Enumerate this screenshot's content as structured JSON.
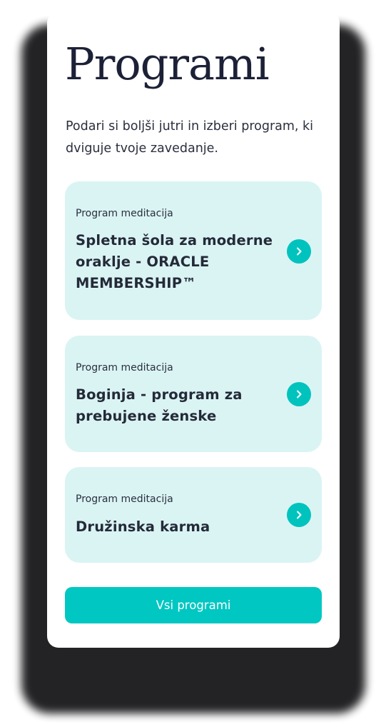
{
  "page": {
    "title": "Programi",
    "subtitle": "Podari si boljši jutri in izberi program, ki dviguje tvoje zavedanje."
  },
  "programs": [
    {
      "tag": "Program meditacija",
      "title": "Spletna šola za moderne oraklje - ORACLE MEMBERSHIP™",
      "icon": "chevron-right-icon"
    },
    {
      "tag": "Program meditacija",
      "title": "Boginja - program za prebujene ženske",
      "icon": "chevron-right-icon"
    },
    {
      "tag": "Program meditacija",
      "title": "Družinska karma",
      "icon": "chevron-right-icon"
    }
  ],
  "all_button": {
    "label": "Vsi programi"
  },
  "colors": {
    "accent": "#00c7c2",
    "card_bg": "#daf4f4",
    "title_text": "#1d2137"
  }
}
